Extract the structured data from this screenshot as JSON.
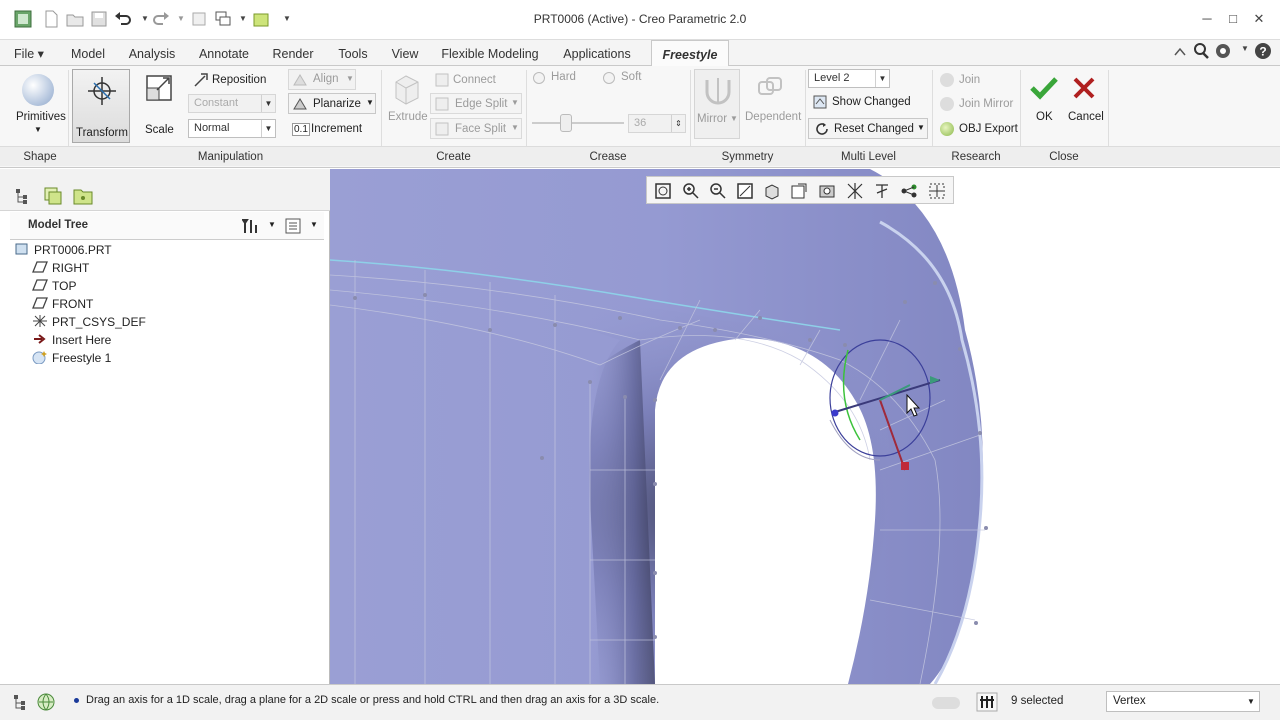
{
  "window": {
    "title": "PRT0006 (Active) - Creo Parametric 2.0"
  },
  "tabs": [
    {
      "label": "File"
    },
    {
      "label": "Model"
    },
    {
      "label": "Analysis"
    },
    {
      "label": "Annotate"
    },
    {
      "label": "Render"
    },
    {
      "label": "Tools"
    },
    {
      "label": "View"
    },
    {
      "label": "Flexible Modeling"
    },
    {
      "label": "Applications"
    },
    {
      "label": "Freestyle"
    }
  ],
  "ribbon": {
    "shape": {
      "group": "Shape",
      "primitives": "Primitives"
    },
    "manipulation": {
      "group": "Manipulation",
      "transform": "Transform",
      "scale": "Scale",
      "reposition": "Reposition",
      "constant": "Constant",
      "normal": "Normal",
      "align": "Align",
      "planarize": "Planarize",
      "increment_prefix": "0.1",
      "increment": "Increment"
    },
    "create": {
      "group": "Create",
      "extrude": "Extrude",
      "connect": "Connect",
      "edge_split": "Edge Split",
      "face_split": "Face Split"
    },
    "crease": {
      "group": "Crease",
      "hard": "Hard",
      "soft": "Soft",
      "value": "36"
    },
    "symmetry": {
      "group": "Symmetry",
      "mirror": "Mirror",
      "dependent": "Dependent"
    },
    "multilevel": {
      "group": "Multi Level",
      "level": "Level 2",
      "show_changed": "Show Changed",
      "reset_changed": "Reset Changed"
    },
    "research": {
      "group": "Research",
      "join": "Join",
      "join_mirror": "Join Mirror",
      "obj_export": "OBJ Export"
    },
    "close": {
      "group": "Close",
      "ok": "OK",
      "cancel": "Cancel"
    }
  },
  "model_tree": {
    "header": "Model Tree",
    "items": [
      {
        "label": "PRT0006.PRT",
        "icon": "part-icon"
      },
      {
        "label": "RIGHT",
        "icon": "datum-plane-icon"
      },
      {
        "label": "TOP",
        "icon": "datum-plane-icon"
      },
      {
        "label": "FRONT",
        "icon": "datum-plane-icon"
      },
      {
        "label": "PRT_CSYS_DEF",
        "icon": "csys-icon"
      },
      {
        "label": "Insert Here",
        "icon": "insert-arrow-icon"
      },
      {
        "label": "Freestyle 1",
        "icon": "freestyle-icon"
      }
    ]
  },
  "status": {
    "message": "Drag an axis for a 1D scale, drag a plane for a 2D scale or press and hold CTRL and then drag an axis for a 3D scale.",
    "selected": "9 selected",
    "filter": "Vertex"
  },
  "colors": {
    "surface": "#8f94cf",
    "accent_ok": "#3aa63a",
    "accent_cancel": "#b02020"
  }
}
